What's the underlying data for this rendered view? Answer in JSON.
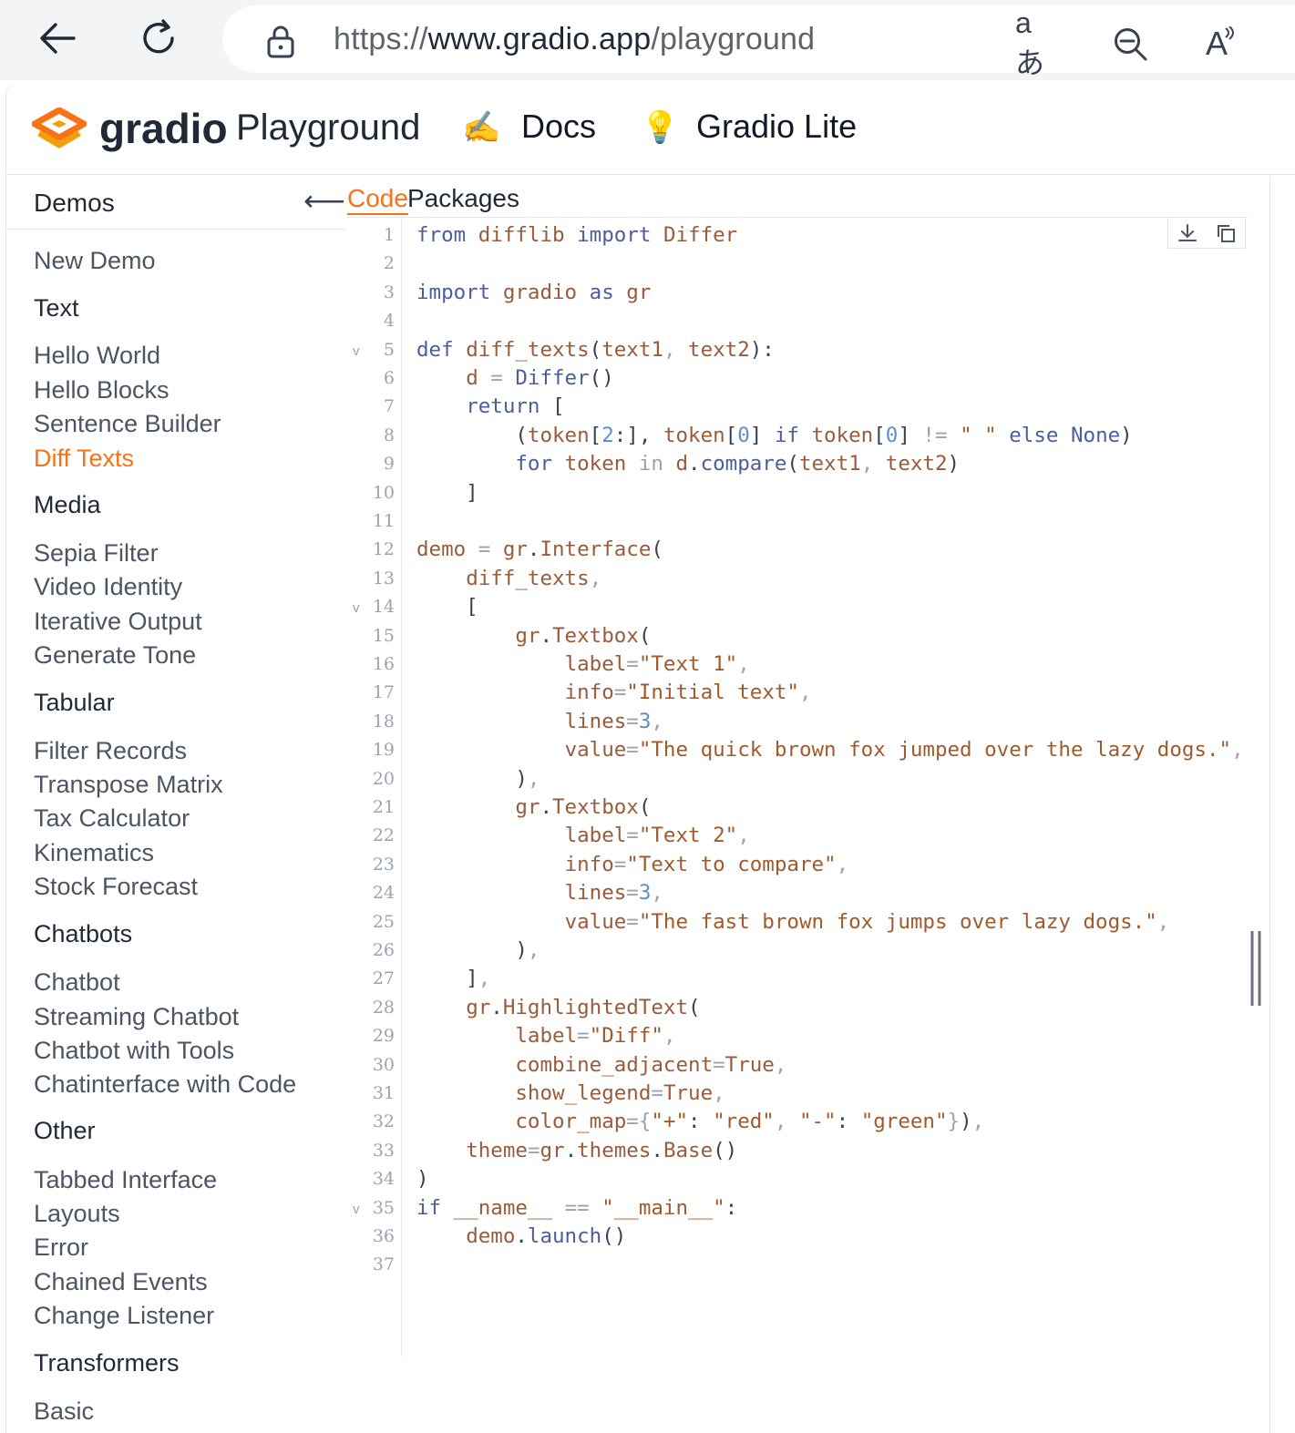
{
  "browser": {
    "url_scheme": "https://",
    "url_host": "www.gradio.app",
    "url_path": "/playground",
    "translate_glyph": "aあ",
    "read_aloud_glyph": "A"
  },
  "header": {
    "logo_word": "gradio",
    "logo_sub": "Playground",
    "docs_label": "Docs",
    "lite_label": "Gradio Lite",
    "docs_icon": "✍",
    "lite_icon": "💡"
  },
  "sidebar": {
    "title": "Demos",
    "collapse_glyph": "⟵",
    "new_demo": "New Demo",
    "categories": [
      {
        "name": "Text",
        "items": [
          "Hello World",
          "Hello Blocks",
          "Sentence Builder",
          "Diff Texts"
        ]
      },
      {
        "name": "Media",
        "items": [
          "Sepia Filter",
          "Video Identity",
          "Iterative Output",
          "Generate Tone"
        ]
      },
      {
        "name": "Tabular",
        "items": [
          "Filter Records",
          "Transpose Matrix",
          "Tax Calculator",
          "Kinematics",
          "Stock Forecast"
        ]
      },
      {
        "name": "Chatbots",
        "items": [
          "Chatbot",
          "Streaming Chatbot",
          "Chatbot with Tools",
          "Chatinterface with Code"
        ]
      },
      {
        "name": "Other",
        "items": [
          "Tabbed Interface",
          "Layouts",
          "Error",
          "Chained Events",
          "Change Listener"
        ]
      },
      {
        "name": "Transformers",
        "items": [
          "Basic"
        ]
      }
    ],
    "active_item": "Diff Texts"
  },
  "tabs": {
    "code": "Code",
    "packages": "Packages"
  },
  "editor": {
    "line_numbers": [
      "1",
      "2",
      "3",
      "4",
      "5",
      "6",
      "7",
      "8",
      "9",
      "10",
      "11",
      "12",
      "13",
      "14",
      "15",
      "16",
      "17",
      "18",
      "19",
      "20",
      "21",
      "22",
      "23",
      "24",
      "25",
      "26",
      "27",
      "28",
      "29",
      "30",
      "31",
      "32",
      "33",
      "34",
      "35",
      "36",
      "37"
    ],
    "fold_markers": [
      "v",
      "v",
      "v"
    ]
  },
  "colors": {
    "accent": "#f97316",
    "keyword": "#4c5d9e",
    "name": "#9a5b3a",
    "string": "#a05a2c",
    "number": "#5b8fc9"
  },
  "icons": [
    "back-arrow-icon",
    "refresh-icon",
    "lock-icon",
    "translate-icon",
    "zoom-out-icon",
    "read-aloud-icon",
    "gradio-logo-icon",
    "writing-hand-icon",
    "lightbulb-icon",
    "download-icon",
    "copy-icon"
  ]
}
